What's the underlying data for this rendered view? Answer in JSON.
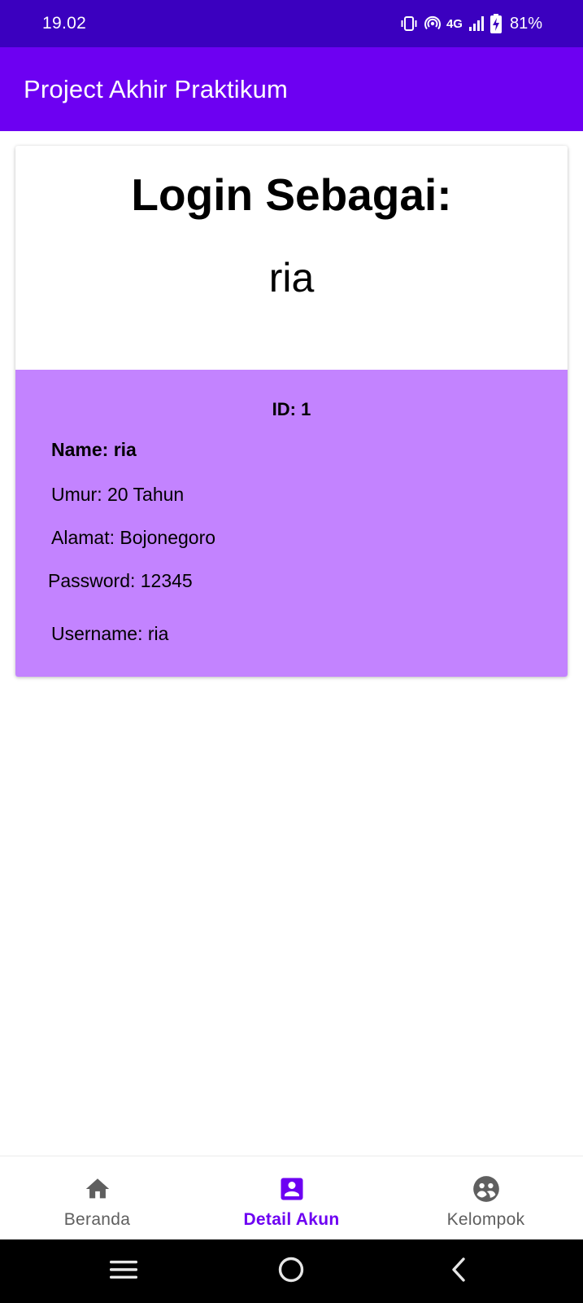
{
  "status_bar": {
    "time": "19.02",
    "network": "4G",
    "battery": "81%"
  },
  "app_bar": {
    "title": "Project Akhir Praktikum"
  },
  "card": {
    "heading": "Login Sebagai:",
    "logged_user": "ria",
    "id_line": "ID: 1",
    "name_line": "Name: ria",
    "umur_line": "Umur: 20 Tahun",
    "alamat_line": "Alamat: Bojonegoro",
    "password_line": "Password: 12345",
    "username_line": "Username: ria"
  },
  "bottom_nav": {
    "items": [
      {
        "label": "Beranda",
        "icon": "home-icon",
        "active": false
      },
      {
        "label": "Detail Akun",
        "icon": "account-box-icon",
        "active": true
      },
      {
        "label": "Kelompok",
        "icon": "group-icon",
        "active": false
      }
    ]
  },
  "colors": {
    "status_bar": "#3b00bf",
    "app_bar": "#6d00f2",
    "details_bg": "#c383ff",
    "nav_active": "#6d00f2",
    "nav_inactive": "#5f5f5f"
  }
}
